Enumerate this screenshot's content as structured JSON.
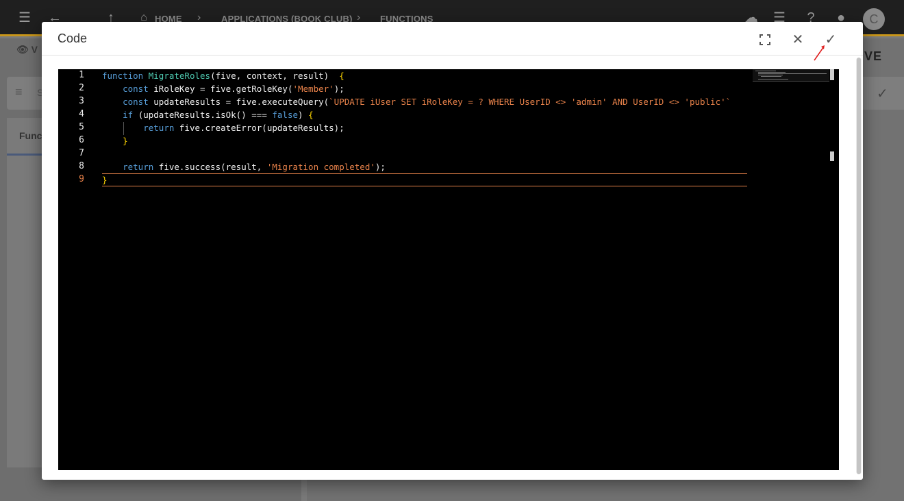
{
  "background": {
    "breadcrumbs": [
      "HOME",
      "APPLICATIONS (BOOK CLUB)",
      "FUNCTIONS"
    ],
    "avatar_letter": "C",
    "view_label": "V",
    "search_placeholder": "S",
    "tab_label": "Funct",
    "brand_fragment": "VE"
  },
  "modal": {
    "title": "Code",
    "fullscreen_icon": "fullscreen-icon",
    "close_icon": "close-icon",
    "confirm_icon": "check-icon"
  },
  "editor": {
    "active_line": 9,
    "lines": [
      {
        "n": "1"
      },
      {
        "n": "2"
      },
      {
        "n": "3"
      },
      {
        "n": "4"
      },
      {
        "n": "5"
      },
      {
        "n": "6"
      },
      {
        "n": "7"
      },
      {
        "n": "8"
      },
      {
        "n": "9"
      }
    ],
    "code": {
      "l1_kw": "function",
      "l1_fn": "MigrateRoles",
      "l1_params": "(five, context, result)",
      "l1_brace": "{",
      "l2_kw": "const",
      "l2_rest": " iRoleKey = five.getRoleKey(",
      "l2_str": "'Member'",
      "l2_end": ");",
      "l3_kw": "const",
      "l3_rest": " updateResults = five.executeQuery(",
      "l3_str": "`UPDATE iUser SET iRoleKey = ? WHERE UserID <> 'admin' AND UserID <> 'public'`",
      "l4_kw": "if",
      "l4_rest": " (updateResults.isOk() === ",
      "l4_kw2": "false",
      "l4_end": ") ",
      "l4_brace": "{",
      "l5_kw": "return",
      "l5_rest": " five.createError(updateResults);",
      "l6_brace": "}",
      "l8_kw": "return",
      "l8_rest": " five.success(result, ",
      "l8_str": "'Migration completed'",
      "l8_end": ");",
      "l9_brace": "}"
    }
  },
  "colors": {
    "keyword": "#569cd6",
    "function_name": "#4ec9b0",
    "string": "#e8824a",
    "bracket": "#ffd700",
    "active_line_number": "#e8824a"
  }
}
